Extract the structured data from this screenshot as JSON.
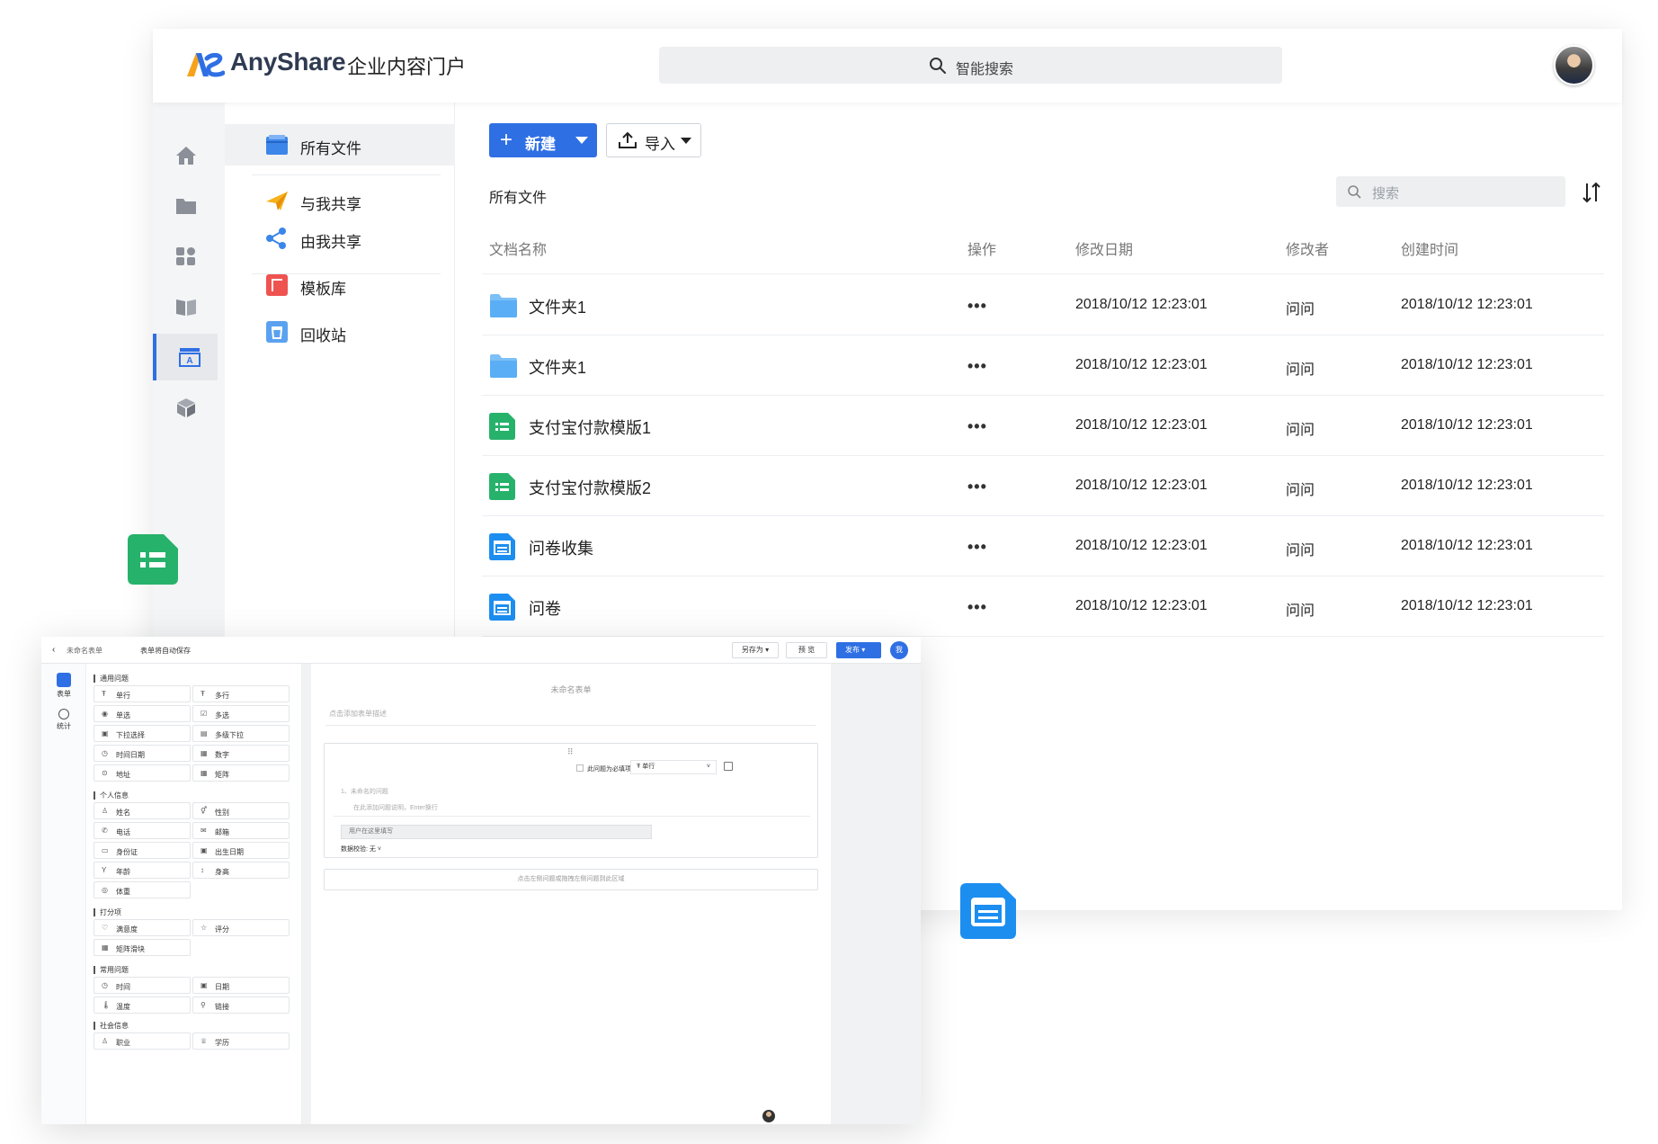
{
  "app": {
    "logo_text": "AnyShare",
    "subtitle": "企业内容门户",
    "search_placeholder": "智能搜索",
    "accent_color": "#2f6fe4"
  },
  "rail": {
    "items": [
      {
        "icon": "home-icon"
      },
      {
        "icon": "folder-icon"
      },
      {
        "icon": "apps-grid-icon"
      },
      {
        "icon": "book-icon"
      },
      {
        "icon": "form-app-icon",
        "active": true
      },
      {
        "icon": "cube-icon"
      }
    ]
  },
  "nav": {
    "items": [
      {
        "label": "所有文件",
        "icon": "all-files-icon",
        "active": true
      },
      {
        "label": "与我共享",
        "icon": "paper-plane-icon"
      },
      {
        "label": "由我共享",
        "icon": "share-icon"
      },
      {
        "label": "模板库",
        "icon": "template-icon"
      },
      {
        "label": "回收站",
        "icon": "trash-icon"
      }
    ]
  },
  "toolbar": {
    "new_label": "新建",
    "import_label": "导入"
  },
  "breadcrumb": "所有文件",
  "file_search_placeholder": "搜索",
  "table": {
    "headers": {
      "name": "文档名称",
      "action": "操作",
      "modified": "修改日期",
      "modifier": "修改者",
      "created": "创建时间"
    },
    "rows": [
      {
        "type": "folder",
        "name": "文件夹1",
        "action": "•••",
        "modified": "2018/10/12  12:23:01",
        "modifier": "问问",
        "created": "2018/10/12  12:23:01"
      },
      {
        "type": "folder",
        "name": "文件夹1",
        "action": "•••",
        "modified": "2018/10/12  12:23:01",
        "modifier": "问问",
        "created": "2018/10/12  12:23:01"
      },
      {
        "type": "sheet",
        "name": "支付宝付款模版1",
        "action": "•••",
        "modified": "2018/10/12  12:23:01",
        "modifier": "问问",
        "created": "2018/10/12  12:23:01"
      },
      {
        "type": "sheet",
        "name": "支付宝付款模版2",
        "action": "•••",
        "modified": "2018/10/12  12:23:01",
        "modifier": "问问",
        "created": "2018/10/12  12:23:01"
      },
      {
        "type": "form",
        "name": "问卷收集",
        "action": "•••",
        "modified": "2018/10/12  12:23:01",
        "modifier": "问问",
        "created": "2018/10/12  12:23:01"
      },
      {
        "type": "form",
        "name": "问卷",
        "action": "•••",
        "modified": "2018/10/12  12:23:01",
        "modifier": "问问",
        "created": "2018/10/12  12:23:01"
      }
    ]
  },
  "editor": {
    "back": "‹",
    "form_name": "未命名表单",
    "autosave": "表单将自动保存",
    "save_as": "另存为 ▾",
    "preview": "预 览",
    "publish": "发布 ▾",
    "avatar_letter": "我",
    "rail": [
      {
        "label": "表单",
        "icon": "form-edit-icon"
      },
      {
        "label": "统计",
        "icon": "stats-icon"
      }
    ],
    "sections": [
      {
        "title": "通用问题",
        "items": [
          {
            "icon": "Ŧ",
            "label": "单行"
          },
          {
            "icon": "Ŧ",
            "label": "多行"
          },
          {
            "icon": "◉",
            "label": "单选"
          },
          {
            "icon": "☑",
            "label": "多选"
          },
          {
            "icon": "▣",
            "label": "下拉选择"
          },
          {
            "icon": "▤",
            "label": "多级下拉"
          },
          {
            "icon": "◷",
            "label": "时间日期"
          },
          {
            "icon": "▦",
            "label": "数字"
          },
          {
            "icon": "⊙",
            "label": "地址"
          },
          {
            "icon": "▦",
            "label": "矩阵"
          }
        ]
      },
      {
        "title": "个人信息",
        "items": [
          {
            "icon": "♙",
            "label": "姓名"
          },
          {
            "icon": "⚥",
            "label": "性别"
          },
          {
            "icon": "✆",
            "label": "电话"
          },
          {
            "icon": "✉",
            "label": "邮箱"
          },
          {
            "icon": "▭",
            "label": "身份证"
          },
          {
            "icon": "▣",
            "label": "出生日期"
          },
          {
            "icon": "Y",
            "label": "年龄"
          },
          {
            "icon": "↕",
            "label": "身高"
          },
          {
            "icon": "◎",
            "label": "体重"
          }
        ]
      },
      {
        "title": "打分项",
        "items": [
          {
            "icon": "♡",
            "label": "满意度"
          },
          {
            "icon": "☆",
            "label": "评分"
          },
          {
            "icon": "▦",
            "label": "矩阵滑块"
          }
        ]
      },
      {
        "title": "常用问题",
        "items": [
          {
            "icon": "◷",
            "label": "时间"
          },
          {
            "icon": "▣",
            "label": "日期"
          },
          {
            "icon": "🌡",
            "label": "温度"
          },
          {
            "icon": "⚲",
            "label": "链接"
          }
        ]
      },
      {
        "title": "社会信息",
        "items": [
          {
            "icon": "♙",
            "label": "职业"
          },
          {
            "icon": "♕",
            "label": "学历"
          }
        ]
      }
    ],
    "canvas": {
      "title": "未命名表单",
      "desc": "点击添加表单描述",
      "drag": "⠿",
      "required": "此问题为必填项",
      "qtype": "Ŧ  单行",
      "qtitle": "1、未命名的问题",
      "qhint": "在此添加问题说明，Enter换行",
      "answer_placeholder": "用户在这里填写",
      "validate": "数据校验:   无   ˅",
      "dropzone": "点击左侧问题或拖拽左侧问题到此区域"
    }
  }
}
